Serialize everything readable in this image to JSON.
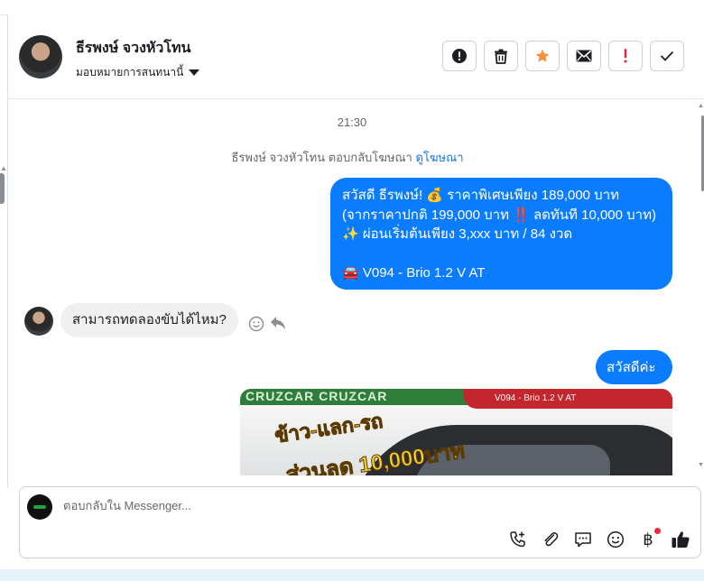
{
  "header": {
    "contact_name": "ธีรพงษ์ จวงหัวโทน",
    "assign_label": "มอบหมายการสนทนานี้"
  },
  "actions": [
    {
      "name": "spam-button",
      "icon": "alert-circle-icon"
    },
    {
      "name": "delete-button",
      "icon": "trash-icon"
    },
    {
      "name": "star-button",
      "icon": "star-icon",
      "color": "#f5923e"
    },
    {
      "name": "mark-unread-button",
      "icon": "envelope-icon"
    },
    {
      "name": "follow-up-button",
      "icon": "exclamation-icon",
      "color": "#e4252d"
    },
    {
      "name": "done-button",
      "icon": "check-icon"
    }
  ],
  "thread": {
    "timestamp": "21:30",
    "ad_reply_text": "ธีรพงษ์ จวงหัวโทน ตอบกลับโฆษณา",
    "ad_link": "ดูโฆษณา",
    "outgoing_1": {
      "line1": "สวัสดี ธีรพงษ์! 💰 ราคาพิเศษเพียง 189,000 บาท",
      "line2": "(จากราคาปกติ 199,000 บาท ‼️ ลดทันที 10,000 บาท)",
      "line3": "✨ ผ่อนเริ่มต้นเพียง 3,xxx บาท / 84 งวด",
      "line4": "🚘 V094 - Brio 1.2 V AT"
    },
    "incoming_1": "สามารถทดลองขับได้ไหม?",
    "outgoing_2": "สวัสดีค่ะ",
    "image": {
      "top_text": "CRUZCAR CRUZCAR",
      "model_text": "V094 - Brio 1.2 V AT",
      "promo_line1": "ข้าว-แลก-รถ",
      "promo_line2": "ส่วนลด 10,000บาท"
    }
  },
  "composer": {
    "placeholder": "ตอบกลับใน Messenger..."
  },
  "tools": [
    {
      "name": "call-add-icon"
    },
    {
      "name": "attach-icon"
    },
    {
      "name": "saved-reply-icon"
    },
    {
      "name": "emoji-icon"
    },
    {
      "name": "payment-icon",
      "label": "฿"
    },
    {
      "name": "like-icon"
    }
  ],
  "colors": {
    "accent": "#0a7cff",
    "incoming_bubble": "#f0f0f0",
    "link": "#1b74e4"
  }
}
